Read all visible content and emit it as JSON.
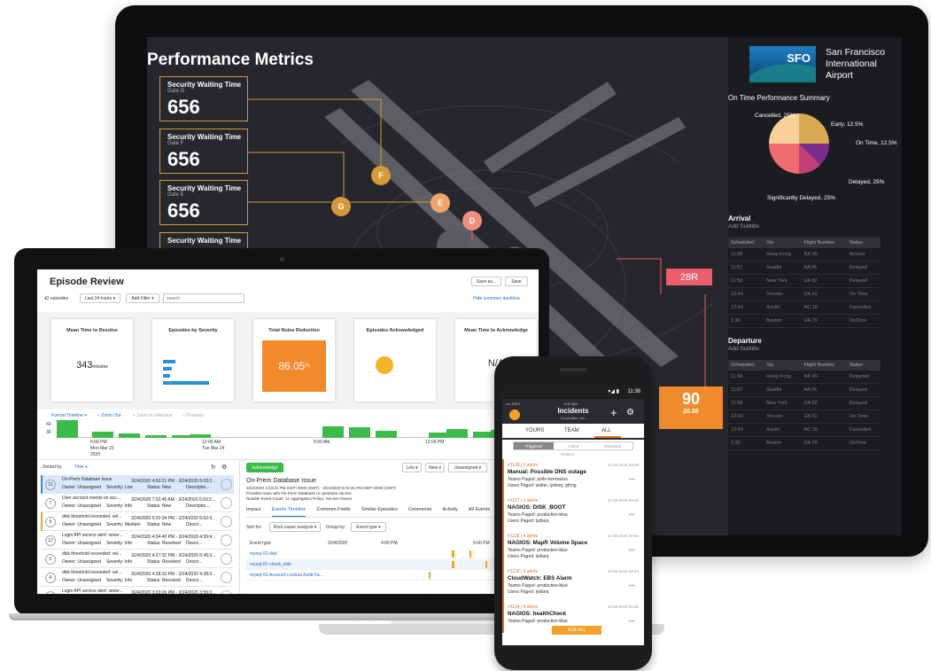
{
  "monitor": {
    "title": "Performance Metrics",
    "metric_cards": [
      {
        "title": "Security Waiting Time",
        "gate": "Gate G",
        "value": "656"
      },
      {
        "title": "Security Waiting Time",
        "gate": "Gate F",
        "value": "656"
      },
      {
        "title": "Security Waiting Time",
        "gate": "Gate E",
        "value": "656"
      },
      {
        "title": "Security Waiting Time",
        "gate": "",
        "value": ""
      }
    ],
    "gates": [
      "G",
      "F",
      "E",
      "D"
    ],
    "runway": "28R",
    "tile": {
      "value": "90",
      "sub": "20.86"
    },
    "airport": {
      "logo": "SFO",
      "name": "San Francisco International Airport"
    },
    "otp_title": "On Time Performance Summary",
    "pie": {
      "slices": [
        {
          "label": "Cancelled, 25%",
          "value": 25,
          "color": "#d9a954"
        },
        {
          "label": "Early, 12.5%",
          "value": 12.5,
          "color": "#7b2d8b"
        },
        {
          "label": "On Time, 12.5%",
          "value": 12.5,
          "color": "#c0407a"
        },
        {
          "label": "Delayed, 25%",
          "value": 25,
          "color": "#ee6b6f"
        },
        {
          "label": "Significantly Delayed, 25%",
          "value": 25,
          "color": "#f7d199"
        }
      ]
    },
    "arrival": {
      "title": "Arrival",
      "subtitle": "Add Subtitle",
      "headers": [
        "Scheduled",
        "Via",
        "Flight Number",
        "Status"
      ],
      "rows": [
        [
          "11:58",
          "Hong Kong",
          "NK 65",
          "Arrived"
        ],
        [
          "11:57",
          "Seattle",
          "AA 06",
          "Delayed"
        ],
        [
          "11:58",
          "New York",
          "UA 92",
          "Delayed"
        ],
        [
          "12:43",
          "Toronto",
          "UA 31",
          "On Time"
        ],
        [
          "12:43",
          "Austin",
          "AC 16",
          "Cancelled"
        ],
        [
          "1:30",
          "Boston",
          "UA 79",
          "OnTime"
        ]
      ]
    },
    "departure": {
      "title": "Departure",
      "subtitle": "Add Subtitle",
      "headers": [
        "Scheduled",
        "Via",
        "Flight Number",
        "Status"
      ],
      "rows": [
        [
          "11:58",
          "Hong Kong",
          "NK 65",
          "Departed"
        ],
        [
          "11:57",
          "Seattle",
          "AA 06",
          "Delayed"
        ],
        [
          "11:58",
          "New York",
          "UA 92",
          "Delayed"
        ],
        [
          "12:43",
          "Toronto",
          "UA 31",
          "On Time"
        ],
        [
          "12:43",
          "Austin",
          "AC 16",
          "Cancelled"
        ],
        [
          "1:30",
          "Boston",
          "UA 79",
          "OnTime"
        ]
      ]
    }
  },
  "laptop": {
    "title": "Episode Review",
    "episodes_count": "42 episodes",
    "time_filter": "Last 24 hours ▾",
    "add_filter": "Add Filter ▾",
    "search_placeholder": "search",
    "save_as": "Save as...",
    "save": "Save",
    "hide_link": "Hide summary dashboa",
    "cards": [
      {
        "title": "Mean Time to Resolve",
        "value": "343",
        "unit": "minutes"
      },
      {
        "title": "Episodes by Severity",
        "value": "",
        "unit": ""
      },
      {
        "title": "Total Noise Reduction",
        "value": "86.05",
        "unit": "%"
      },
      {
        "title": "Episodes Acknowledged",
        "value": "",
        "unit": ""
      },
      {
        "title": "Mean Time to Acknowledge",
        "value": "N/A",
        "unit": ""
      }
    ],
    "timeline_tools": {
      "format": "Format Timeline ▾",
      "zoom": "– Zoom Out",
      "zoom_sel": "+ Zoom to Selection",
      "deselect": "× Deselect"
    },
    "timeline_axis": {
      "y_top": "60",
      "y_mid": "30",
      "t1": "6:00 PM",
      "t1b": "Mon Mar 23",
      "t1c": "2020",
      "t2": "12:00 AM",
      "t2b": "Tue Mar 24",
      "t3": "6:00 AM",
      "t4": "12:00 PM"
    },
    "timeline_bars": [
      60,
      20,
      15,
      10,
      8,
      12,
      40,
      35,
      25,
      18,
      30,
      22,
      28,
      32
    ],
    "sort": {
      "label": "Sorted by",
      "field": "Time ▾"
    },
    "rows": [
      {
        "count": "11",
        "title": "On-Prem Database Issue",
        "time": "3/24/2020 4:03:21 PM - 3/24/2020 5:03:2...",
        "owner": "Owner: Unassigned",
        "sev": "Severity: Low",
        "status": "Status: New",
        "desc": "Descriptio..."
      },
      {
        "count": "7",
        "title": "User account events on acc...",
        "time": "3/24/2020 7:32:45 AM - 3/24/2020 5:03:2...",
        "owner": "Owner: Unassigned",
        "sev": "Severity: Info",
        "status": "Status: New",
        "desc": "Descriptio..."
      },
      {
        "count": "5",
        "title": "disk threshold exceeded: vel...",
        "time": "3/24/2020 5:02:34 PM - 3/24/2020 5:02:3...",
        "owner": "Owner: Unassigned",
        "sev": "Severity: Medium",
        "status": "Status: New",
        "desc": "Descri..."
      },
      {
        "count": "12",
        "title": "Login API service alert: sever...",
        "time": "3/24/2020 4:04:40 PM - 3/24/2020 4:59:4...",
        "owner": "Owner: Unassigned",
        "sev": "Severity: Info",
        "status": "Status: Resolved",
        "desc": "Descri..."
      },
      {
        "count": "2",
        "title": "disk threshold exceeded: vel...",
        "time": "3/24/2020 4:27:32 PM - 3/24/2020 6:49:3...",
        "owner": "Owner: Unassigned",
        "sev": "Severity: Info",
        "status": "Status: Resolved",
        "desc": "Descri..."
      },
      {
        "count": "4",
        "title": "disk threshold exceeded: vel...",
        "time": "3/24/2020 4:28:32 PM - 3/24/2020 4:28:3...",
        "owner": "Owner: Unassigned",
        "sev": "Severity: Info",
        "status": "Status: Resolved",
        "desc": "Descri..."
      },
      {
        "count": "1",
        "title": "Login API service alert: sever...",
        "time": "3/24/2020 3:03:26 PM - 3/24/2020 3:59:3...",
        "owner": "",
        "sev": "",
        "status": "",
        "desc": ""
      }
    ],
    "detail": {
      "ack": "Acknowledge",
      "low": "Low ▾",
      "new": "New ▾",
      "unassigned": "Unassigned ▾",
      "title": "On-Prem Database Issue",
      "time": "3/24/2020 4:03:21 PM GMT+0000 (GMT) - 3/24/2020 5:03:25 PM GMT+0000 (GMT)",
      "desc": "Possible issue with On-Prem Database or upstream service",
      "notable": "Notable Event Count: 11    Aggregation Policy: Service Issues",
      "tabs": [
        "Impact",
        "Events Timeline",
        "Common Fields",
        "Similar Episodes",
        "Comments",
        "Activity",
        "All Events"
      ],
      "sort_for": "Sort for:",
      "sort_val": "Root cause analysis ▾",
      "group_by": "Group by:",
      "group_val": "Event type ▾",
      "ev_header": [
        "Event type",
        "3/24/2020",
        "4:00 PM",
        "5:00 PM"
      ],
      "events": [
        "mysql-02-disk",
        "mysql-02-check_disk",
        "mysql-03-Account Lockout Audit Fa..."
      ]
    }
  },
  "phone": {
    "status_time": "11:38",
    "inner_time": "9:47 AM",
    "carrier": "•••• AT&T",
    "app_title": "Incidents",
    "app_sub": "Greymatter, Inc.",
    "tabs": [
      "YOURS",
      "TEAM",
      "ALL"
    ],
    "seg": [
      "Triggered",
      "Acked",
      "Resolved"
    ],
    "newest": "Newest",
    "incidents": [
      {
        "alerts": "#1128  |  1 alerts",
        "date": "11-08-2016 09:48",
        "name": "Manual:  Possible DNS outage",
        "team": "Teams Paged: pollo-hermanos",
        "users": "Users Paged: walter, lydiarq, gfring"
      },
      {
        "alerts": "#1127  |  1 alerts",
        "date": "11-08-2016 09:48",
        "name": "NAGIOS:  DISK_BOOT",
        "team": "Teams Paged: production-blue",
        "users": "Users Paged: lydiarq"
      },
      {
        "alerts": "#1126  |  4 alerts",
        "date": "11-08-2016 09:43",
        "name": "NAGIOS:  MapR Volume Space",
        "team": "Teams Paged: production-blue",
        "users": "Users Paged: lydiarq"
      },
      {
        "alerts": "#1125  |  2 alerts",
        "date": "11-08-2016 09:43",
        "name": "CloudWatch:  EBS Alarm",
        "team": "Teams Paged: production-blue",
        "users": "Users Paged: lydiarq"
      },
      {
        "alerts": "#1124  |  4 alerts",
        "date": "11-08-2016 09:31",
        "name": "NAGIOS:  healthCheck",
        "team": "Teams Paged: production-blue",
        "users": ""
      }
    ],
    "ack_all": "ACK ALL"
  }
}
